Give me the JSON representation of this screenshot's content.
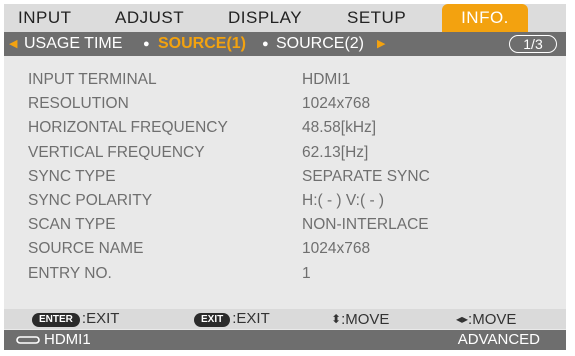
{
  "menu": {
    "tabs": [
      {
        "label": "INPUT"
      },
      {
        "label": "ADJUST"
      },
      {
        "label": "DISPLAY"
      },
      {
        "label": "SETUP"
      },
      {
        "label": "INFO."
      }
    ],
    "active_tab": "INFO."
  },
  "subtabs": {
    "items": [
      {
        "label": "USAGE TIME"
      },
      {
        "label": "SOURCE(1)"
      },
      {
        "label": "SOURCE(2)"
      }
    ],
    "active": "SOURCE(1)",
    "page_indicator": "1/3"
  },
  "info": {
    "rows": [
      {
        "label": "INPUT TERMINAL",
        "value": "HDMI1"
      },
      {
        "label": "RESOLUTION",
        "value": "1024x768"
      },
      {
        "label": "HORIZONTAL FREQUENCY",
        "value": "48.58[kHz]"
      },
      {
        "label": "VERTICAL FREQUENCY",
        "value": "62.13[Hz]"
      },
      {
        "label": "SYNC TYPE",
        "value": "SEPARATE SYNC"
      },
      {
        "label": "SYNC POLARITY",
        "value": "H:( - ) V:( - )"
      },
      {
        "label": "SCAN TYPE",
        "value": "NON-INTERLACE"
      },
      {
        "label": "SOURCE NAME",
        "value": "1024x768"
      },
      {
        "label": "ENTRY NO.",
        "value": "1"
      }
    ]
  },
  "hints": {
    "enter_key": "ENTER",
    "enter_action": ":EXIT",
    "exit_key": "EXIT",
    "exit_action": ":EXIT",
    "updown_action": ":MOVE",
    "leftright_action": ":MOVE"
  },
  "status": {
    "source_icon": "hdmi-connector-icon",
    "source": "HDMI1",
    "mode": "ADVANCED"
  },
  "colors": {
    "accent": "#f3a20f",
    "menubar_bg": "#dcdcdc",
    "subbar_bg": "#6e6e6e",
    "panel_bg": "#e9e9e9",
    "text_gray": "#6f6f6f"
  }
}
